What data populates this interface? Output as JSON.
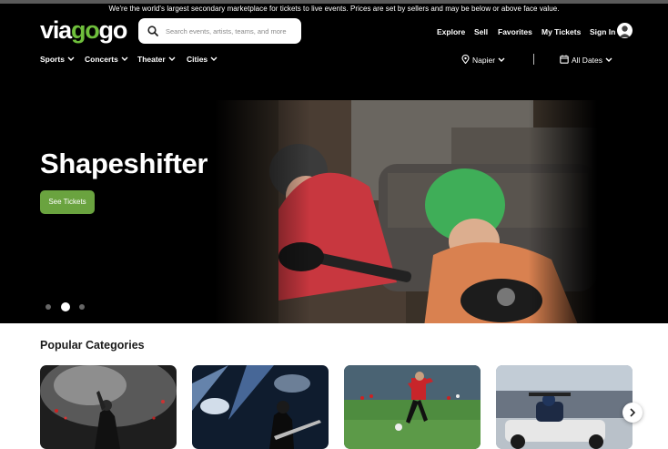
{
  "banner": "We're the world's largest secondary marketplace for tickets to live events. Prices are set by sellers and may be below or above face value.",
  "logo": {
    "part1": "via",
    "part2": "go",
    "part3": "go"
  },
  "search": {
    "placeholder": "Search events, artists, teams, and more"
  },
  "topnav": {
    "explore": "Explore",
    "sell": "Sell",
    "favorites": "Favorites",
    "my_tickets": "My Tickets",
    "sign_in": "Sign In"
  },
  "categories_nav": [
    "Sports",
    "Concerts",
    "Theater",
    "Cities"
  ],
  "filters": {
    "location": "Napier",
    "dates": "All Dates"
  },
  "hero": {
    "title": "Shapeshifter",
    "cta": "See Tickets",
    "carousel": {
      "slides": 3,
      "active": 2
    }
  },
  "popular": {
    "title": "Popular Categories"
  },
  "icons": [
    "search-icon",
    "avatar-icon",
    "chevron-down-icon",
    "location-pin-icon",
    "calendar-icon",
    "chevron-right-icon"
  ],
  "colors": {
    "accent": "#6fbf3c",
    "cta": "#6aa33f",
    "background": "#000000"
  }
}
